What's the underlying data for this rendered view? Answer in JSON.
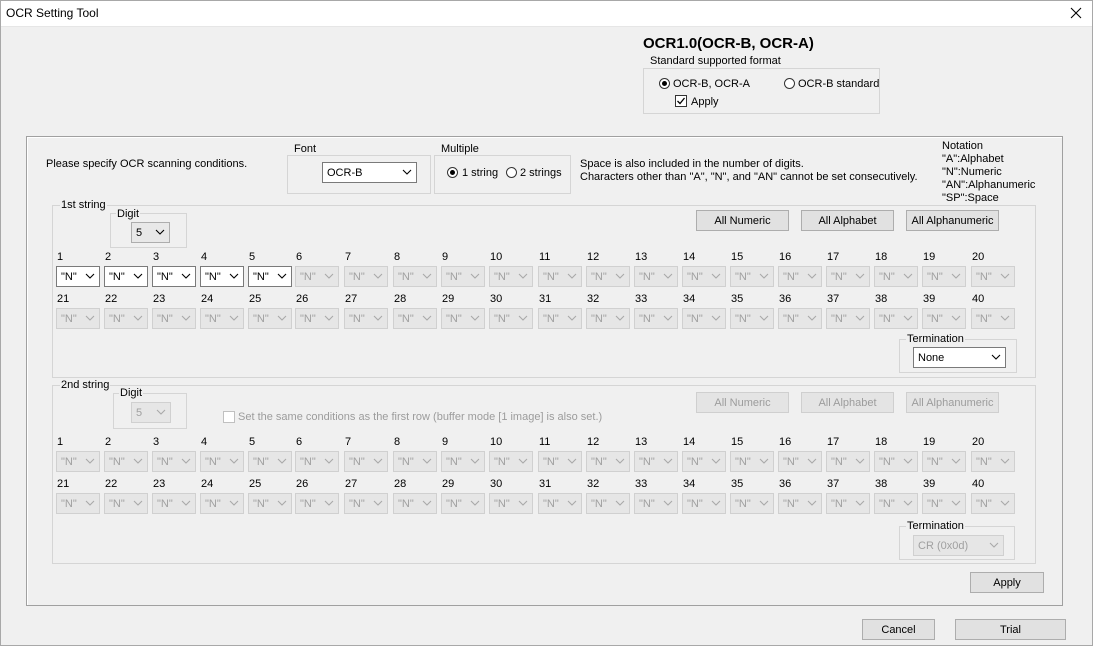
{
  "window": {
    "title": "OCR Setting Tool"
  },
  "heading": "OCR1.0(OCR-B, OCR-A)",
  "standard_format": {
    "label": "Standard supported format",
    "option1": "OCR-B, OCR-A",
    "option2": "OCR-B standard",
    "apply_label": "Apply",
    "option1_selected": true,
    "apply_checked": true
  },
  "instructions": "Please specify OCR scanning conditions.",
  "font": {
    "label": "Font",
    "value": "OCR-B"
  },
  "multiple": {
    "label": "Multiple",
    "option1": "1 string",
    "option2": "2 strings",
    "selected": "1 string"
  },
  "notes": {
    "line1": "Space is also included in the number of digits.",
    "line2": "Characters other than \"A\", \"N\", and \"AN\" cannot be set consecutively."
  },
  "notation": {
    "title": "Notation",
    "items": [
      "\"A\":Alphabet",
      "\"N\":Numeric",
      "\"AN\":Alphanumeric",
      "\"SP\":Space"
    ]
  },
  "string1": {
    "label": "1st string",
    "digit_label": "Digit",
    "digit_value": "5",
    "buttons": {
      "numeric": "All Numeric",
      "alphabet": "All Alphabet",
      "alphanumeric": "All Alphanumeric"
    },
    "positions": [
      "1",
      "2",
      "3",
      "4",
      "5",
      "6",
      "7",
      "8",
      "9",
      "10",
      "11",
      "12",
      "13",
      "14",
      "15",
      "16",
      "17",
      "18",
      "19",
      "20",
      "21",
      "22",
      "23",
      "24",
      "25",
      "26",
      "27",
      "28",
      "29",
      "30",
      "31",
      "32",
      "33",
      "34",
      "35",
      "36",
      "37",
      "38",
      "39",
      "40"
    ],
    "values": [
      "\"N\"",
      "\"N\"",
      "\"N\"",
      "\"N\"",
      "\"N\"",
      "\"N\"",
      "\"N\"",
      "\"N\"",
      "\"N\"",
      "\"N\"",
      "\"N\"",
      "\"N\"",
      "\"N\"",
      "\"N\"",
      "\"N\"",
      "\"N\"",
      "\"N\"",
      "\"N\"",
      "\"N\"",
      "\"N\"",
      "\"N\"",
      "\"N\"",
      "\"N\"",
      "\"N\"",
      "\"N\"",
      "\"N\"",
      "\"N\"",
      "\"N\"",
      "\"N\"",
      "\"N\"",
      "\"N\"",
      "\"N\"",
      "\"N\"",
      "\"N\"",
      "\"N\"",
      "\"N\"",
      "\"N\"",
      "\"N\"",
      "\"N\"",
      "\"N\""
    ],
    "enabled_count": 5,
    "termination_label": "Termination",
    "termination_value": "None"
  },
  "string2": {
    "label": "2nd string",
    "digit_label": "Digit",
    "digit_value": "5",
    "same_conditions_label": "Set the same conditions as the first row (buffer mode [1 image] is also set.)",
    "buttons": {
      "numeric": "All Numeric",
      "alphabet": "All Alphabet",
      "alphanumeric": "All Alphanumeric"
    },
    "positions": [
      "1",
      "2",
      "3",
      "4",
      "5",
      "6",
      "7",
      "8",
      "9",
      "10",
      "11",
      "12",
      "13",
      "14",
      "15",
      "16",
      "17",
      "18",
      "19",
      "20",
      "21",
      "22",
      "23",
      "24",
      "25",
      "26",
      "27",
      "28",
      "29",
      "30",
      "31",
      "32",
      "33",
      "34",
      "35",
      "36",
      "37",
      "38",
      "39",
      "40"
    ],
    "values": [
      "\"N\"",
      "\"N\"",
      "\"N\"",
      "\"N\"",
      "\"N\"",
      "\"N\"",
      "\"N\"",
      "\"N\"",
      "\"N\"",
      "\"N\"",
      "\"N\"",
      "\"N\"",
      "\"N\"",
      "\"N\"",
      "\"N\"",
      "\"N\"",
      "\"N\"",
      "\"N\"",
      "\"N\"",
      "\"N\"",
      "\"N\"",
      "\"N\"",
      "\"N\"",
      "\"N\"",
      "\"N\"",
      "\"N\"",
      "\"N\"",
      "\"N\"",
      "\"N\"",
      "\"N\"",
      "\"N\"",
      "\"N\"",
      "\"N\"",
      "\"N\"",
      "\"N\"",
      "\"N\"",
      "\"N\"",
      "\"N\"",
      "\"N\"",
      "\"N\""
    ],
    "enabled_count": 0,
    "termination_label": "Termination",
    "termination_value": "CR (0x0d)"
  },
  "apply_button": "Apply",
  "cancel_button": "Cancel",
  "trial_button": "Trial",
  "colors": {
    "disabled_text": "#9c9c9c",
    "button_face": "#e1e1e1",
    "window_bg": "#f0f0f0"
  }
}
